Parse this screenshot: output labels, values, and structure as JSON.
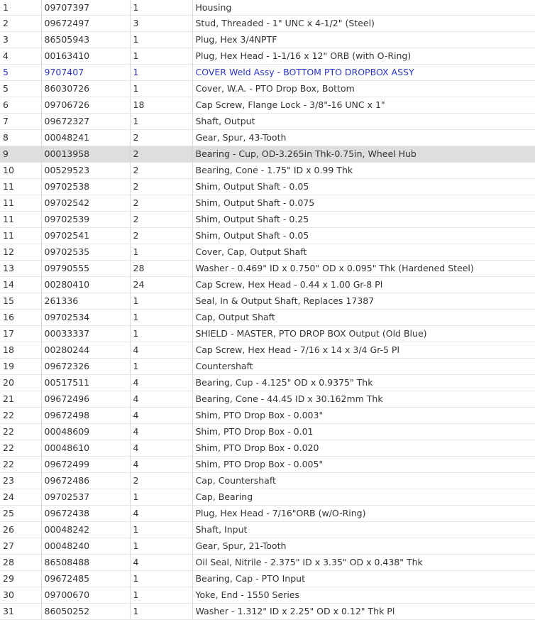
{
  "colors": {
    "text": "#333333",
    "link": "#2a35c8",
    "highlight_row": "#dedede",
    "border": "#d8d8d8"
  },
  "parts_table": {
    "rows": [
      {
        "ref": "1",
        "part": "09707397",
        "qty": "1",
        "desc": "Housing",
        "link": false,
        "highlighted": false
      },
      {
        "ref": "2",
        "part": "09672497",
        "qty": "3",
        "desc": "Stud, Threaded - 1\" UNC x 4-1/2\" (Steel)",
        "link": false,
        "highlighted": false
      },
      {
        "ref": "3",
        "part": "86505943",
        "qty": "1",
        "desc": "Plug, Hex 3/4NPTF",
        "link": false,
        "highlighted": false
      },
      {
        "ref": "4",
        "part": "00163410",
        "qty": "1",
        "desc": "Plug, Hex Head - 1-1/16 x 12\" ORB (with O-Ring)",
        "link": false,
        "highlighted": false
      },
      {
        "ref": "5",
        "part": "9707407",
        "qty": "1",
        "desc": "COVER Weld Assy - BOTTOM PTO DROPBOX ASSY",
        "link": true,
        "highlighted": false
      },
      {
        "ref": "5",
        "part": "86030726",
        "qty": "1",
        "desc": "Cover, W.A. - PTO Drop Box, Bottom",
        "link": false,
        "highlighted": false
      },
      {
        "ref": "6",
        "part": "09706726",
        "qty": "18",
        "desc": "Cap Screw, Flange Lock - 3/8\"-16 UNC x 1\"",
        "link": false,
        "highlighted": false
      },
      {
        "ref": "7",
        "part": "09672327",
        "qty": "1",
        "desc": "Shaft, Output",
        "link": false,
        "highlighted": false
      },
      {
        "ref": "8",
        "part": "00048241",
        "qty": "2",
        "desc": "Gear, Spur, 43-Tooth",
        "link": false,
        "highlighted": false
      },
      {
        "ref": "9",
        "part": "00013958",
        "qty": "2",
        "desc": "Bearing - Cup, OD-3.265in Thk-0.75in, Wheel Hub",
        "link": false,
        "highlighted": true
      },
      {
        "ref": "10",
        "part": "00529523",
        "qty": "2",
        "desc": "Bearing, Cone - 1.75\" ID x 0.99 Thk",
        "link": false,
        "highlighted": false
      },
      {
        "ref": "11",
        "part": "09702538",
        "qty": "2",
        "desc": "Shim, Output Shaft - 0.05",
        "link": false,
        "highlighted": false
      },
      {
        "ref": "11",
        "part": "09702542",
        "qty": "2",
        "desc": "Shim, Output Shaft - 0.075",
        "link": false,
        "highlighted": false
      },
      {
        "ref": "11",
        "part": "09702539",
        "qty": "2",
        "desc": "Shim, Output Shaft - 0.25",
        "link": false,
        "highlighted": false
      },
      {
        "ref": "11",
        "part": "09702541",
        "qty": "2",
        "desc": "Shim, Output Shaft - 0.05",
        "link": false,
        "highlighted": false
      },
      {
        "ref": "12",
        "part": "09702535",
        "qty": "1",
        "desc": "Cover, Cap, Output Shaft",
        "link": false,
        "highlighted": false
      },
      {
        "ref": "13",
        "part": "09790555",
        "qty": "28",
        "desc": "Washer - 0.469\" ID x 0.750\" OD x 0.095\" Thk (Hardened Steel)",
        "link": false,
        "highlighted": false
      },
      {
        "ref": "14",
        "part": "00280410",
        "qty": "24",
        "desc": "Cap Screw, Hex Head - 0.44 x 1.00 Gr-8 Pl",
        "link": false,
        "highlighted": false
      },
      {
        "ref": "15",
        "part": "261336",
        "qty": "1",
        "desc": "Seal, In & Output Shaft, Replaces 17387",
        "link": false,
        "highlighted": false
      },
      {
        "ref": "16",
        "part": "09702534",
        "qty": "1",
        "desc": "Cap, Output Shaft",
        "link": false,
        "highlighted": false
      },
      {
        "ref": "17",
        "part": "00033337",
        "qty": "1",
        "desc": "SHIELD - MASTER, PTO DROP BOX Output (Old Blue)",
        "link": false,
        "highlighted": false
      },
      {
        "ref": "18",
        "part": "00280244",
        "qty": "4",
        "desc": "Cap Screw, Hex Head - 7/16 x 14 x 3/4 Gr-5 Pl",
        "link": false,
        "highlighted": false
      },
      {
        "ref": "19",
        "part": "09672326",
        "qty": "1",
        "desc": "Countershaft",
        "link": false,
        "highlighted": false
      },
      {
        "ref": "20",
        "part": "00517511",
        "qty": "4",
        "desc": "Bearing, Cup - 4.125\" OD x 0.9375\" Thk",
        "link": false,
        "highlighted": false
      },
      {
        "ref": "21",
        "part": "09672496",
        "qty": "4",
        "desc": "Bearing, Cone - 44.45 ID x 30.162mm Thk",
        "link": false,
        "highlighted": false
      },
      {
        "ref": "22",
        "part": "09672498",
        "qty": "4",
        "desc": "Shim, PTO Drop Box - 0.003\"",
        "link": false,
        "highlighted": false
      },
      {
        "ref": "22",
        "part": "00048609",
        "qty": "4",
        "desc": "Shim, PTO Drop Box - 0.01",
        "link": false,
        "highlighted": false
      },
      {
        "ref": "22",
        "part": "00048610",
        "qty": "4",
        "desc": "Shim, PTO Drop Box - 0.020",
        "link": false,
        "highlighted": false
      },
      {
        "ref": "22",
        "part": "09672499",
        "qty": "4",
        "desc": "Shim, PTO Drop Box - 0.005\"",
        "link": false,
        "highlighted": false
      },
      {
        "ref": "23",
        "part": "09672486",
        "qty": "2",
        "desc": "Cap, Countershaft",
        "link": false,
        "highlighted": false
      },
      {
        "ref": "24",
        "part": "09702537",
        "qty": "1",
        "desc": "Cap, Bearing",
        "link": false,
        "highlighted": false
      },
      {
        "ref": "25",
        "part": "09672438",
        "qty": "4",
        "desc": "Plug, Hex Head - 7/16\"ORB (w/O-Ring)",
        "link": false,
        "highlighted": false
      },
      {
        "ref": "26",
        "part": "00048242",
        "qty": "1",
        "desc": "Shaft, Input",
        "link": false,
        "highlighted": false
      },
      {
        "ref": "27",
        "part": "00048240",
        "qty": "1",
        "desc": "Gear, Spur, 21-Tooth",
        "link": false,
        "highlighted": false
      },
      {
        "ref": "28",
        "part": "86508488",
        "qty": "4",
        "desc": "Oil Seal, Nitrile - 2.375\" ID x 3.35\" OD x 0.438\" Thk",
        "link": false,
        "highlighted": false
      },
      {
        "ref": "29",
        "part": "09672485",
        "qty": "1",
        "desc": "Bearing, Cap - PTO Input",
        "link": false,
        "highlighted": false
      },
      {
        "ref": "30",
        "part": "09700670",
        "qty": "1",
        "desc": "Yoke, End - 1550 Series",
        "link": false,
        "highlighted": false
      },
      {
        "ref": "31",
        "part": "86050252",
        "qty": "1",
        "desc": "Washer - 1.312\" ID x 2.25\" OD x 0.12\" Thk Pl",
        "link": false,
        "highlighted": false
      }
    ]
  }
}
